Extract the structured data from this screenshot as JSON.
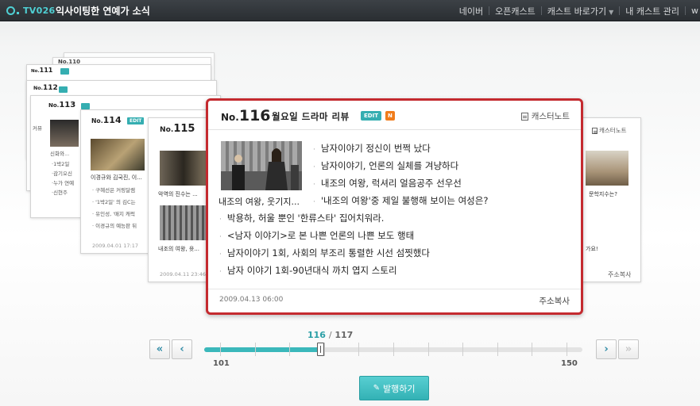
{
  "app": {
    "logo": "TV026",
    "title": "익사이팅한 연예가 소식",
    "nav": [
      "네이버",
      "오픈캐스트",
      "캐스트 바로가기",
      "내 캐스트 관리",
      "w"
    ]
  },
  "bg_cards": {
    "c111": {
      "no": "No.",
      "num": "111"
    },
    "c112": {
      "no": "No.",
      "num": "112"
    },
    "c113": {
      "no": "No.",
      "num": "113",
      "lines": [
        "커뮤",
        "신화와...",
        "·1박2일",
        "·감기오신",
        "·누가 연예",
        "·신현주"
      ]
    },
    "c114": {
      "no": "No.",
      "num": "114",
      "edit": "EDIT",
      "photo_text": "이경규와 김국진, 이...",
      "lines": [
        "구혜선은 커핑달램",
        "'1박2일' 의 김C는",
        "유인성, '매지 캐럭",
        "이경규의 예능판 뒤"
      ],
      "date": "2009.04.01 17:17"
    },
    "c115": {
      "no": "No.",
      "num": "115",
      "caption1": "악역의 진수는 ...",
      "caption2": "내조의 여왕, 윳...",
      "date": "2009.04.11 23:46"
    },
    "c117": {
      "note": "캐스터노트",
      "caption": "문학지수는?",
      "caption2": "가요!",
      "copy": "주소복사"
    }
  },
  "main_card": {
    "no_label": "No.",
    "number": "116",
    "title": "월요일 드라마 리뷰",
    "edit_badge": "EDIT",
    "new_badge": "N",
    "caster_note": "캐스터노트",
    "photo_caption": "내조의 여왕, 웃기지...",
    "items": [
      "남자이야기 정신이 번쩍 났다",
      "남자이야기, 언론의 실체를 겨냥하다",
      "내조의 여왕, 럭셔리 얼음공주 선우선",
      "'내조의 여왕'중 제일 불행해 보이는 여성은?",
      "박용하, 허울 뿐인 '한류스타' 집어치워라.",
      "<남자 이야기>로 본 나쁜 언론의 나쁜 보도 행태",
      "남자이야기 1회, 사회의 부조리 통렬한 시선 섬찟했다",
      "남자 이야기 1회-90년대식 까치 엽지 스토리"
    ],
    "date": "2009.04.13 06:00",
    "copy_address": "주소복사"
  },
  "slider": {
    "current": "116",
    "separator": "/",
    "total": "117",
    "min": "101",
    "max": "150",
    "position_fraction": 0.306
  },
  "publish": {
    "label": "발행하기"
  },
  "icons": {
    "first": "double-chevron-left-icon",
    "prev": "chevron-left-icon",
    "next": "chevron-right-icon",
    "last": "double-chevron-right-icon"
  },
  "colors": {
    "accent": "#3bb8bb",
    "selected_border": "#c42a2f",
    "edit_badge": "#35aeb1",
    "new_badge": "#f07d1c",
    "topbar": "#2e3236"
  }
}
